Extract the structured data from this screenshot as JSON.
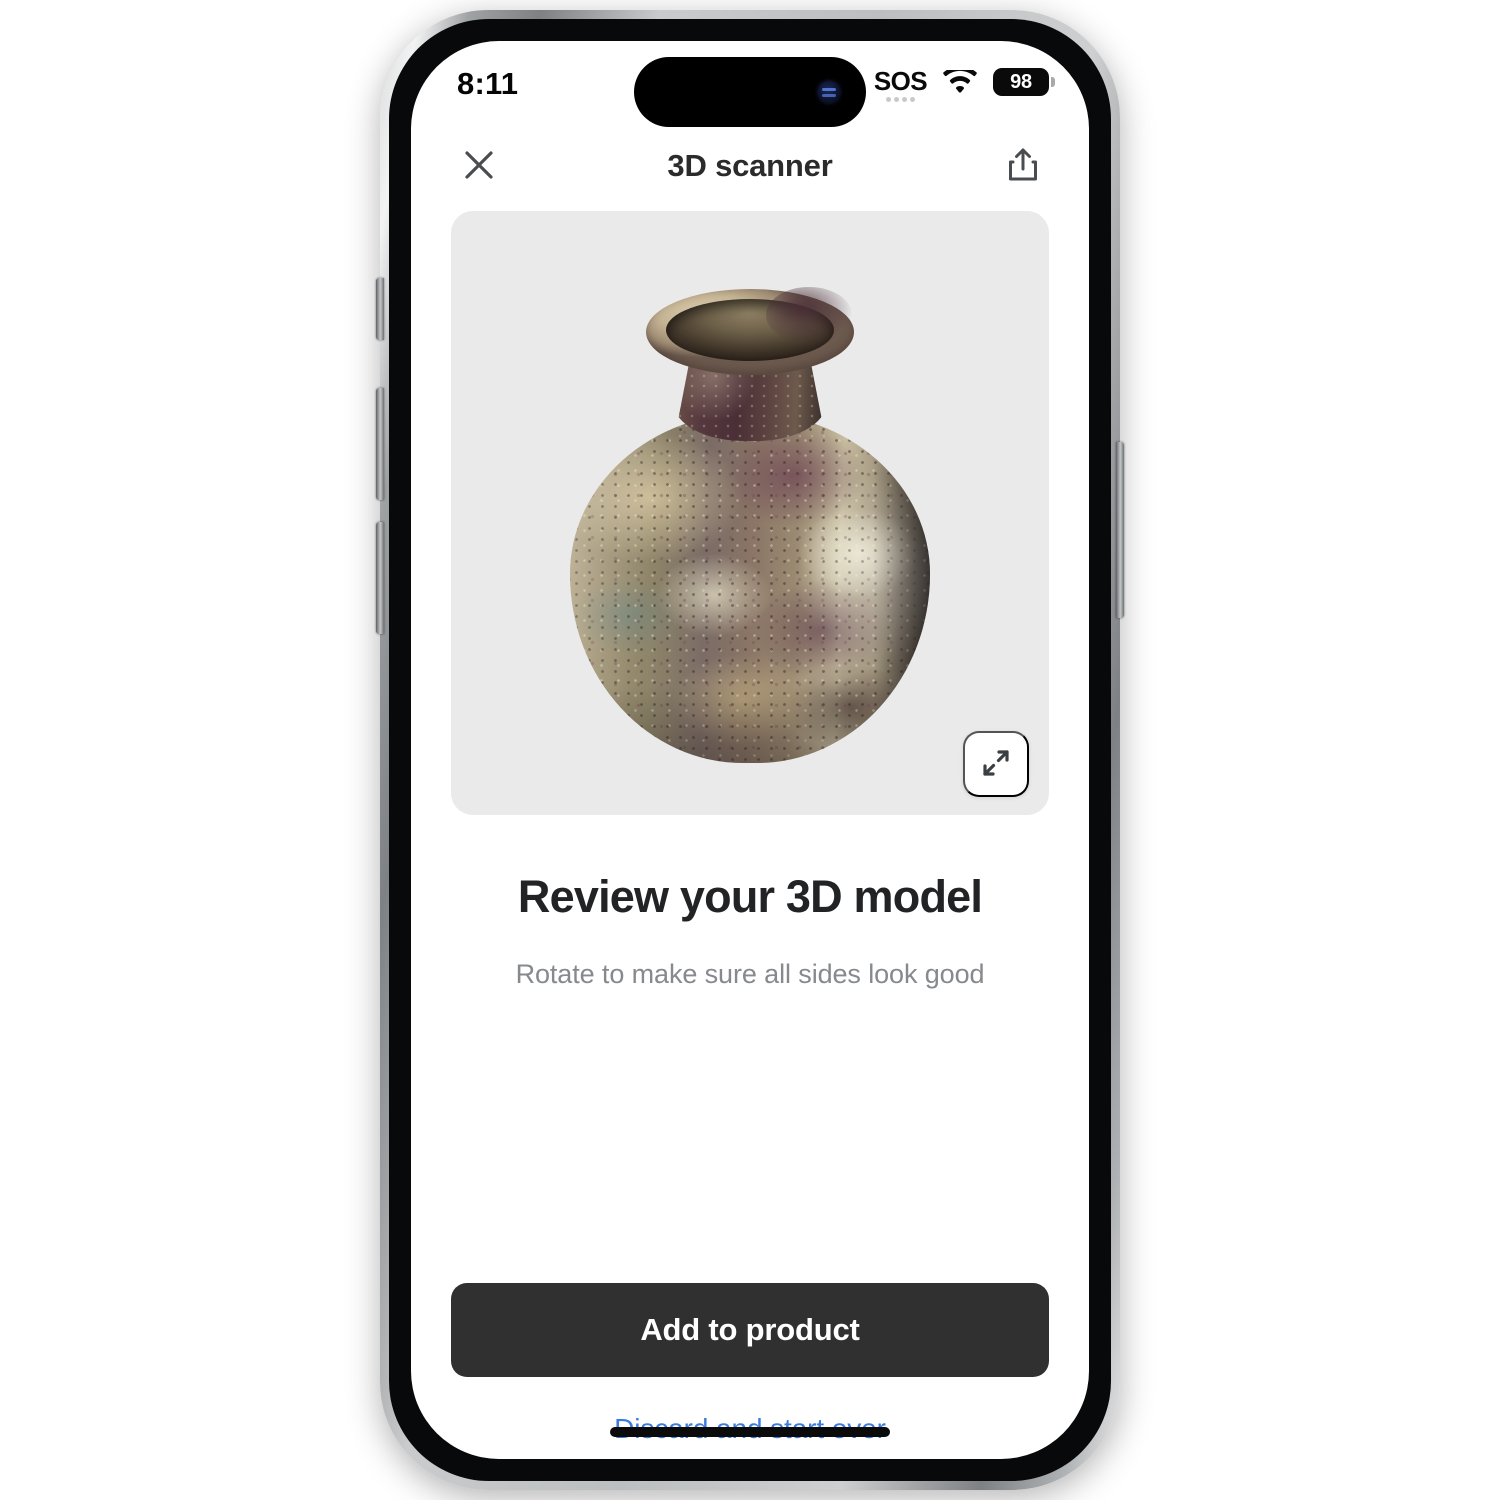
{
  "status_bar": {
    "time": "8:11",
    "sos_label": "SOS",
    "wifi_icon": "wifi-icon",
    "battery_level": "98"
  },
  "nav_bar": {
    "close_icon": "close-icon",
    "title": "3D scanner",
    "share_icon": "share-icon"
  },
  "preview": {
    "model_label": "ceramic vase 3D model",
    "background_color": "#eaeaea",
    "expand_icon": "expand-icon"
  },
  "main": {
    "headline": "Review your 3D model",
    "subline": "Rotate to make sure all sides look good"
  },
  "actions": {
    "primary_label": "Add to product",
    "secondary_label": "Discard and start over",
    "primary_color": "#303030",
    "secondary_color": "#3b7ddd"
  }
}
